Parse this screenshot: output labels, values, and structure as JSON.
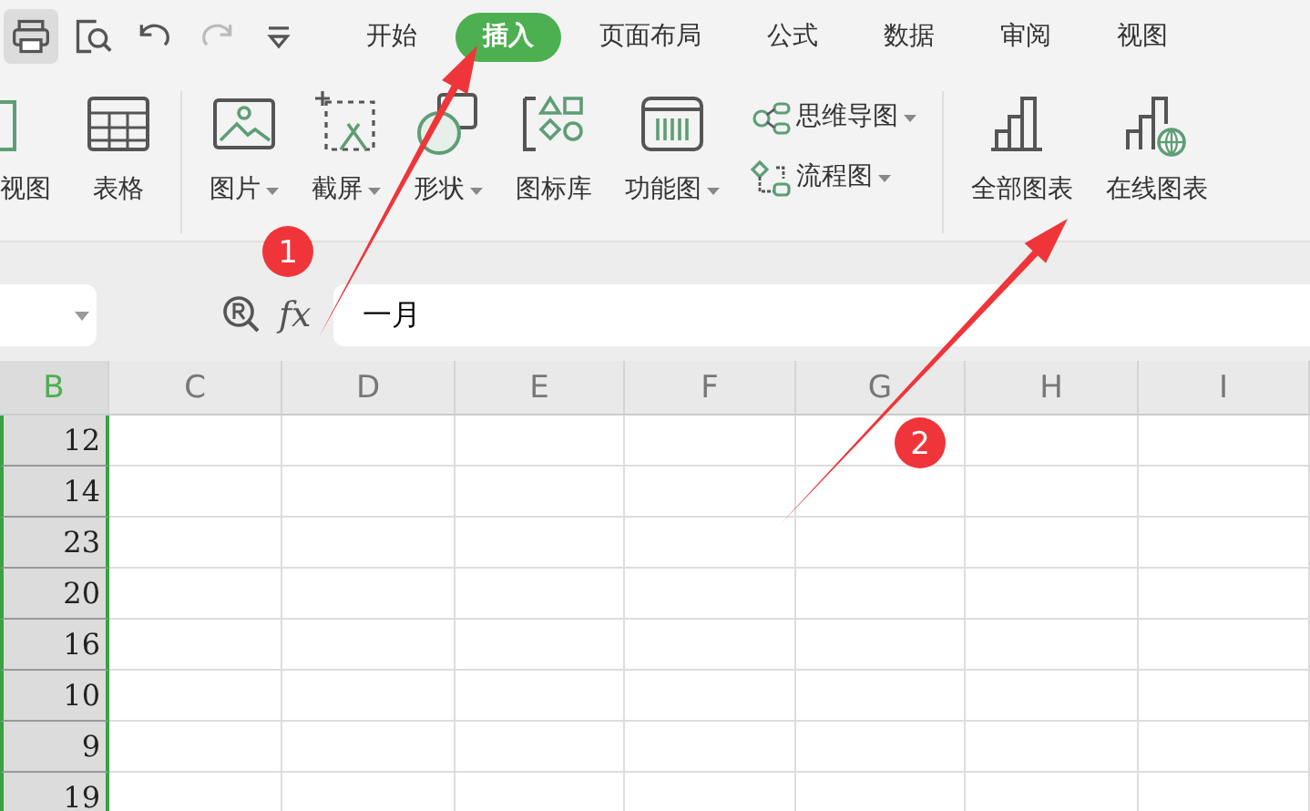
{
  "quick_access": [
    {
      "kind": "print",
      "disabled": false
    },
    {
      "kind": "preview",
      "disabled": false
    },
    {
      "kind": "undo",
      "disabled": false
    },
    {
      "kind": "redo",
      "disabled": true
    },
    {
      "kind": "more",
      "disabled": false
    }
  ],
  "tabs": [
    {
      "label": "开始",
      "selected": false
    },
    {
      "label": "插入",
      "selected": true
    },
    {
      "label": "页面布局",
      "selected": false
    },
    {
      "label": "公式",
      "selected": false
    },
    {
      "label": "数据",
      "selected": false
    },
    {
      "label": "审阅",
      "selected": false
    },
    {
      "label": "视图",
      "selected": false
    }
  ],
  "ribbon": [
    {
      "kind": "large",
      "label": "视图",
      "dropdown": false
    },
    {
      "kind": "large",
      "label": "表格",
      "dropdown": false
    },
    {
      "kind": "separator"
    },
    {
      "kind": "large",
      "label": "图片",
      "dropdown": true
    },
    {
      "kind": "large",
      "label": "截屏",
      "dropdown": true
    },
    {
      "kind": "large",
      "label": "形状",
      "dropdown": true
    },
    {
      "kind": "large",
      "label": "图标库",
      "dropdown": false
    },
    {
      "kind": "large",
      "label": "功能图",
      "dropdown": true
    },
    {
      "kind": "stack",
      "items": [
        {
          "label": "思维导图",
          "dropdown": true
        },
        {
          "label": "流程图",
          "dropdown": true
        }
      ]
    },
    {
      "kind": "separator"
    },
    {
      "kind": "large",
      "label": "全部图表",
      "dropdown": false
    },
    {
      "kind": "large",
      "label": "在线图表",
      "dropdown": false
    }
  ],
  "formula_bar": {
    "fx_label": "fx",
    "value": "一月"
  },
  "columns": [
    {
      "label": "B",
      "selected": true
    },
    {
      "label": "C",
      "selected": false
    },
    {
      "label": "D",
      "selected": false
    },
    {
      "label": "E",
      "selected": false
    },
    {
      "label": "F",
      "selected": false
    },
    {
      "label": "G",
      "selected": false
    },
    {
      "label": "H",
      "selected": false
    },
    {
      "label": "I",
      "selected": false
    }
  ],
  "rows": [
    "12",
    "14",
    "23",
    "20",
    "16",
    "10",
    "9",
    "19"
  ],
  "annotations": [
    {
      "label": "1"
    },
    {
      "label": "2"
    }
  ]
}
